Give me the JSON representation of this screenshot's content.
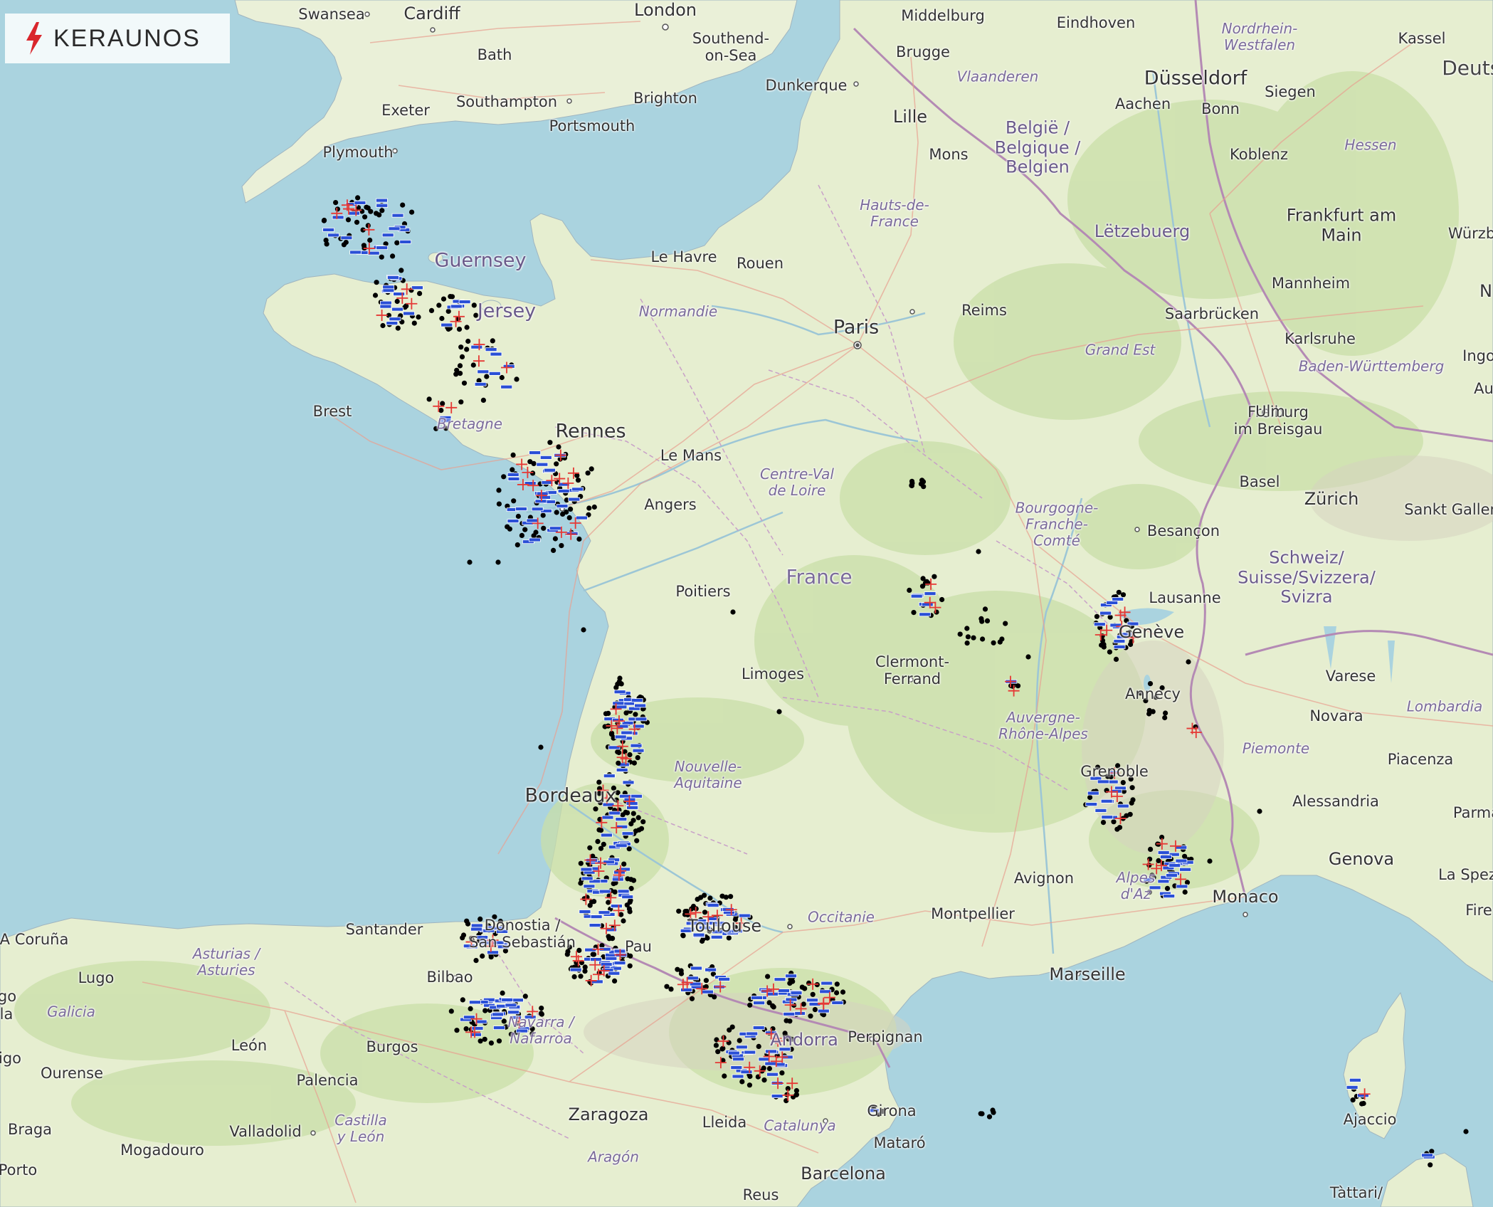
{
  "brand": {
    "logo_text": "KERAUNOS",
    "logo_icon": "lightning-bolt-icon",
    "accent_color": "#d9262c"
  },
  "legend_symbols": {
    "cloud_to_cloud_dot": "#000000",
    "negative_strike": "#2a4fd6",
    "positive_strike": "#e53935"
  },
  "labels": {
    "swansea": "Swansea",
    "cardiff": "Cardiff",
    "london": "London",
    "bath": "Bath",
    "southend": "Southend-\non-Sea",
    "exeter": "Exeter",
    "southampton": "Southampton",
    "brighton": "Brighton",
    "portsmouth": "Portsmouth",
    "plymouth": "Plymouth",
    "middelburg": "Middelburg",
    "eindhoven": "Eindhoven",
    "nrw": "Nordrhein-\nWestfalen",
    "kassel": "Kassel",
    "deutsch": "Deutsc",
    "brugge": "Brugge",
    "vlaanderen": "Vlaanderen",
    "dusseldorf": "Düsseldorf",
    "dunkerque": "Dunkerque",
    "aachen": "Aachen",
    "siegen": "Siegen",
    "lille": "Lille",
    "belgium": "België /\nBelgique /\nBelgien",
    "bonn": "Bonn",
    "mons": "Mons",
    "koblenz": "Koblenz",
    "hessen": "Hessen",
    "hauts": "Hauts-de-\nFrance",
    "frankfurt": "Frankfurt am\nMain",
    "wurzb": "Würzb",
    "letzebuerg": "Lëtzebuerg",
    "guernsey": "Guernsey",
    "lehavre": "Le Havre",
    "rouen": "Rouen",
    "mannheim": "Mannheim",
    "jersey": "Jersey",
    "normandie": "Normandie",
    "reims": "Reims",
    "saarbrucken": "Saarbrücken",
    "paris": "Paris",
    "karlsruhe": "Karlsruhe",
    "grandest": "Grand Est",
    "bw": "Baden-Württemberg",
    "brest": "Brest",
    "bretagne": "Bretagne",
    "freiburg": "Freiburg\nim Breisgau",
    "ulm": "Ulm",
    "rennes": "Rennes",
    "lemans": "Le Mans",
    "cvl": "Centre-Val\nde Loire",
    "angers": "Angers",
    "basel": "Basel",
    "zurich": "Zürich",
    "sanktgallen": "Sankt Gallen",
    "bfc": "Bourgogne-\nFranche-\nComté",
    "besancon": "Besançon",
    "suisse": "Schweiz/\nSuisse/Svizzera/\nSvizra",
    "poitiers": "Poitiers",
    "france": "France",
    "lausanne": "Lausanne",
    "geneve": "Genève",
    "clermont": "Clermont-\nFerrand",
    "limoges": "Limoges",
    "annecy": "Annecy",
    "varese": "Varese",
    "lombardia": "Lombardia",
    "novara": "Novara",
    "ara": "Auvergne-\nRhône-Alpes",
    "piemonte": "Piemonte",
    "na": "Nouvelle-\nAquitaine",
    "grenoble": "Grenoble",
    "piacenza": "Piacenza",
    "bordeaux": "Bordeaux",
    "alessandria": "Alessandria",
    "parma": "Parma",
    "genova": "Genova",
    "avignon": "Avignon",
    "alpes": "Alpes\nd'Az",
    "monaco": "Monaco",
    "laspez": "La Spez",
    "fire": "Fire",
    "montpellier": "Montpellier",
    "occitanie": "Occitanie",
    "santander": "Santander",
    "donostia": "Donostia /\nSan Sebastián",
    "acoruna": "A Coruña",
    "lugo": "Lugo",
    "asturias": "Asturias /\nAsturies",
    "bilbao": "Bilbao",
    "toulouse": "Toulouse",
    "pau": "Pau",
    "marseille": "Marseille",
    "galicia": "Galicia",
    "leon": "León",
    "burgos": "Burgos",
    "navarra": "Navarra /\nNafarroa",
    "andorra": "Andorra",
    "perpignan": "Perpignan",
    "ourense": "Ourense",
    "palencia": "Palencia",
    "cyl": "Castilla\ny León",
    "zaragoza": "Zaragoza",
    "lleida": "Lleida",
    "catalunya": "Catalunya",
    "girona": "Girona",
    "ajaccio": "Ajaccio",
    "braga": "Braga",
    "valladolid": "Valladolid",
    "mogadouro": "Mogadouro",
    "mataro": "Mataró",
    "aragon": "Aragón",
    "porto": "Porto",
    "barcelona": "Barcelona",
    "reus": "Reus",
    "tattari": "Tàttari/",
    "go": "go",
    "ila": "la",
    "igo": "igo",
    "ingo": "Ingo",
    "au": "Au",
    "n": "N"
  }
}
